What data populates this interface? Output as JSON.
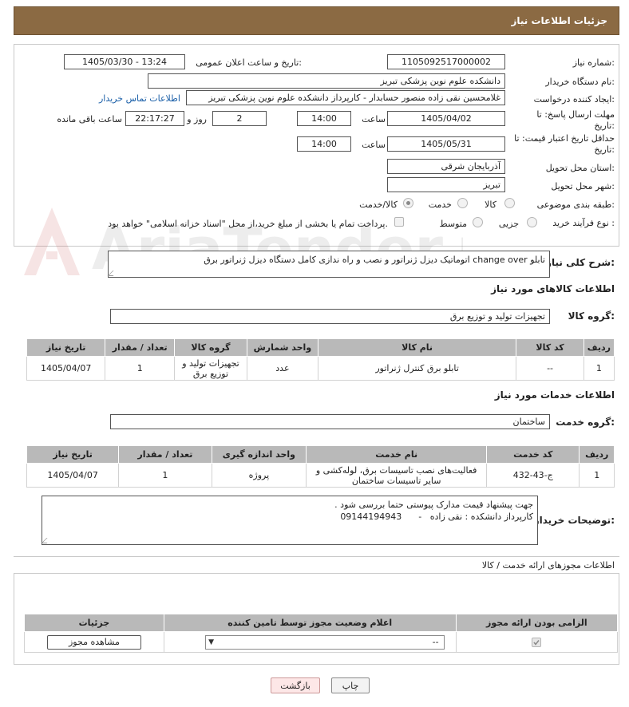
{
  "window": {
    "title": "جزئیات اطلاعات نیاز"
  },
  "form": {
    "need_number_label": "شماره نیاز:",
    "need_number": "1105092517000002",
    "announce_label": "تاریخ و ساعت اعلان عمومی:",
    "announce_value": "1405/03/30 - 13:24",
    "buyer_org_label": "نام دستگاه خریدار:",
    "buyer_org": "دانشکده علوم نوین پزشکی  تبریز",
    "creator_label": "ایجاد کننده درخواست:",
    "creator": "غلامحسین نقی زاده منصور حسابدار - کارپرداز دانشکده علوم نوین پزشکی  تبریز",
    "contact_link": "اطلاعات تماس خریدار",
    "deadline_label": "مهلت ارسال پاسخ: تا تاریخ:",
    "deadline_date": "1405/04/02",
    "time_label": "ساعت",
    "deadline_time": "14:00",
    "days_value": "2",
    "days_label": "روز و",
    "remaining_time": "22:17:27",
    "remaining_label": "ساعت باقی مانده",
    "validity_label": "حداقل تاریخ اعتبار قیمت: تا تاریخ:",
    "validity_date": "1405/05/31",
    "validity_time": "14:00",
    "province_label": "استان محل تحویل:",
    "province": "آذربایجان شرقی",
    "city_label": "شهر محل تحویل:",
    "city": "تبریز",
    "category_label": "طبقه بندی موضوعی:",
    "category_options": [
      "کالا",
      "خدمت",
      "کالا/خدمت"
    ],
    "category_selected": "کالا/خدمت",
    "process_label": "نوع فرآیند خرید :",
    "process_options": [
      "جزیی",
      "متوسط"
    ],
    "process_selected": "",
    "payment_note": "پرداخت تمام یا بخشی از مبلغ خرید،از محل \"اسناد خزانه اسلامی\" خواهد بود."
  },
  "description": {
    "label": "شرح کلی نیاز:",
    "text": "تابلو change over اتوماتیک دیزل ژنراتور و نصب و راه ندازی کامل دستگاه دیزل ژنراتور برق"
  },
  "goods": {
    "section_title": "اطلاعات کالاهای مورد نیاز",
    "group_label": "گروه کالا:",
    "group_value": "تجهیزات تولید و توزیع برق",
    "columns": [
      "ردیف",
      "کد کالا",
      "نام کالا",
      "واحد شمارش",
      "گروه کالا",
      "تعداد / مقدار",
      "تاریخ نیاز"
    ],
    "rows": [
      [
        "1",
        "--",
        "تابلو برق کنترل ژنراتور",
        "عدد",
        "تجهیزات تولید و توزیع برق",
        "1",
        "1405/04/07"
      ]
    ]
  },
  "services": {
    "section_title": "اطلاعات خدمات مورد نیاز",
    "group_label": "گروه خدمت:",
    "group_value": "ساختمان",
    "columns": [
      "ردیف",
      "کد خدمت",
      "نام خدمت",
      "واحد اندازه گیری",
      "تعداد / مقدار",
      "تاریخ نیاز"
    ],
    "rows": [
      [
        "1",
        "ج-43-432",
        "فعالیت‌های نصب تاسیسات برق، لوله‌کشی و سایر تاسیسات ساختمان",
        "پروژه",
        "1",
        "1405/04/07"
      ]
    ]
  },
  "buyer_notes": {
    "label": "توضیحات خریدار:",
    "line1": "جهت پیشنهاد قیمت مدارک پیوستی حتما بررسی شود .",
    "line2": "کارپرداز دانشکده : نقی زاده   -      09144194943"
  },
  "permits": {
    "section_title": "اطلاعات مجوزهای ارائه خدمت / کالا",
    "columns": [
      "الزامی بودن ارائه مجوز",
      "اعلام وضعیت مجوز توسط تامین کننده",
      "جزئیات"
    ],
    "select_value": "--",
    "view_button": "مشاهده مجوز"
  },
  "footer": {
    "print_button": "چاپ",
    "back_button": "بازگشت"
  },
  "watermark": {
    "text": "AriaTender.neT"
  }
}
